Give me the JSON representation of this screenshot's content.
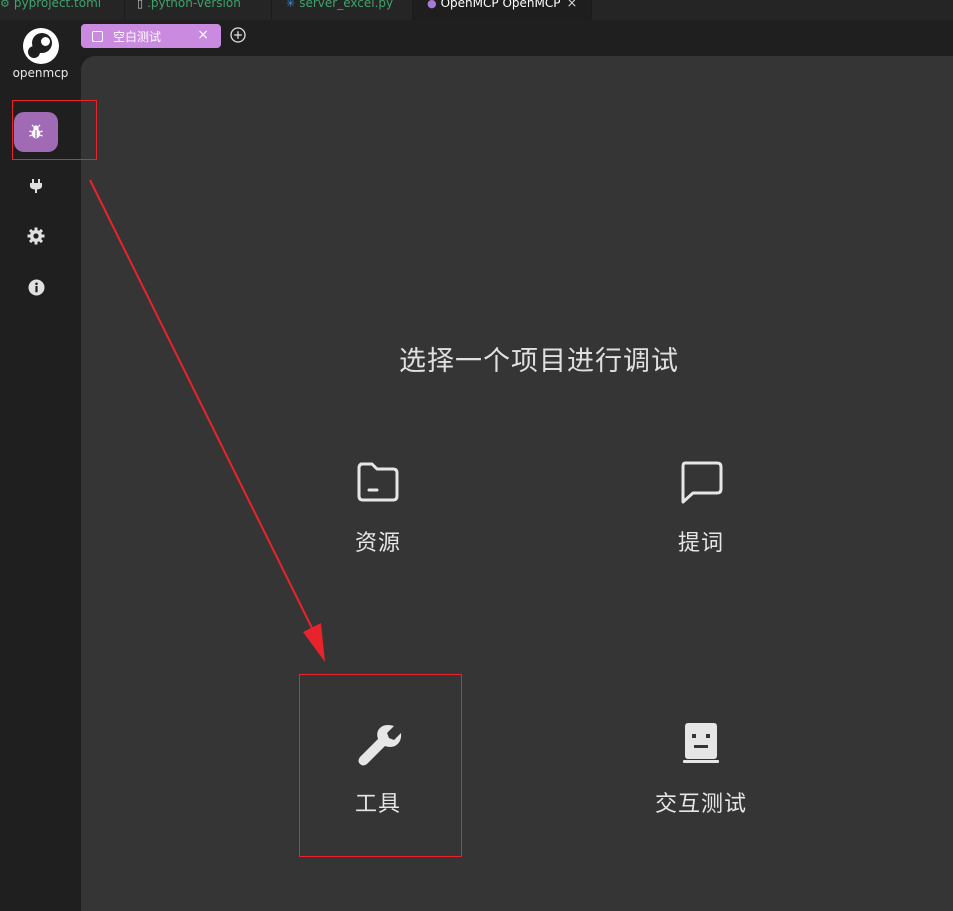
{
  "editor_tabs": [
    {
      "label": "pyproject.toml",
      "icon": "gear-icon"
    },
    {
      "label": ".python-version",
      "icon": "file-icon"
    },
    {
      "label": "server_excel.py",
      "icon": "python-icon"
    },
    {
      "label": "OpenMCP OpenMCP",
      "icon": "openmcp-icon",
      "close": "×"
    }
  ],
  "sidebar": {
    "logo_text": "openmcp",
    "items": [
      {
        "name": "debug",
        "icon": "bug-icon",
        "active": true
      },
      {
        "name": "connect",
        "icon": "plug-icon"
      },
      {
        "name": "settings",
        "icon": "gear-icon"
      },
      {
        "name": "about",
        "icon": "info-icon"
      }
    ]
  },
  "project_tab": {
    "label": "空白测试",
    "close": "×"
  },
  "main": {
    "heading": "选择一个项目进行调试",
    "cards": [
      {
        "label": "资源",
        "icon": "folder-icon"
      },
      {
        "label": "提词",
        "icon": "chat-icon"
      },
      {
        "label": "工具",
        "icon": "wrench-icon"
      },
      {
        "label": "交互测试",
        "icon": "robot-icon"
      }
    ]
  },
  "colors": {
    "accent": "#a06ab4",
    "tab_accent": "#c98ae0",
    "panel_bg": "#363536",
    "annotation": "#e8232b"
  }
}
